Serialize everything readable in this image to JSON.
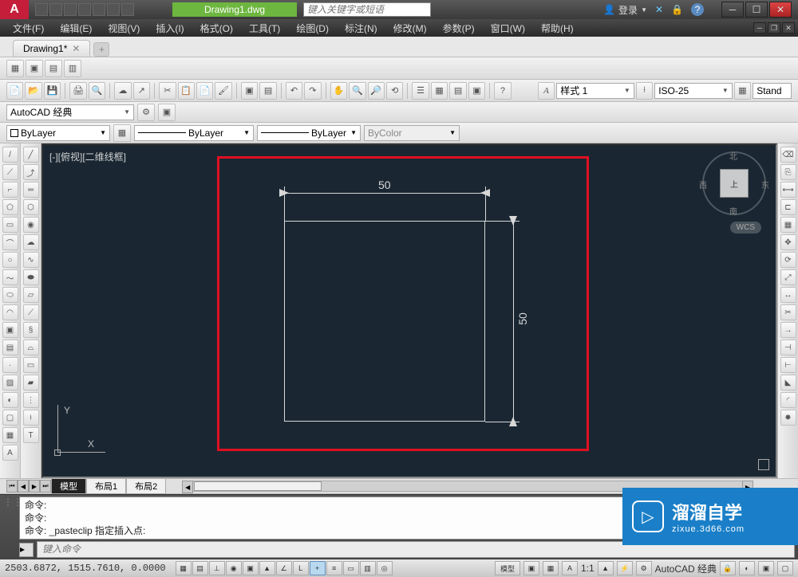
{
  "titlebar": {
    "filename": "Drawing1.dwg",
    "search_placeholder": "键入关键字或短语",
    "login_label": "登录"
  },
  "menu": {
    "items": [
      "文件(F)",
      "编辑(E)",
      "视图(V)",
      "插入(I)",
      "格式(O)",
      "工具(T)",
      "绘图(D)",
      "标注(N)",
      "修改(M)",
      "参数(P)",
      "窗口(W)",
      "帮助(H)"
    ]
  },
  "filetab": {
    "name": "Drawing1*"
  },
  "workspace": {
    "name": "AutoCAD 经典"
  },
  "style_combo": {
    "label": "样式 1"
  },
  "dim_style": {
    "label": "ISO-25"
  },
  "standard": {
    "label": "Stand"
  },
  "layer": {
    "current": "ByLayer",
    "linetype": "ByLayer",
    "lineweight": "ByLayer",
    "color": "ByColor"
  },
  "viewport": {
    "label": "[-][俯视][二维线框]"
  },
  "viewcube": {
    "face": "上",
    "n": "北",
    "s": "南",
    "e": "东",
    "w": "西",
    "wcs": "WCS"
  },
  "ucs": {
    "x": "X",
    "y": "Y"
  },
  "dimensions": {
    "horizontal": "50",
    "vertical": "50"
  },
  "layout_tabs": {
    "model": "模型",
    "layout1": "布局1",
    "layout2": "布局2"
  },
  "command": {
    "line1": "命令:",
    "line2": "命令:",
    "line3": "命令: _pasteclip 指定插入点:",
    "input_placeholder": "键入命令"
  },
  "statusbar": {
    "coords": "2503.6872, 1515.7610, 0.0000",
    "model_btn": "模型",
    "scale": "1:1",
    "workspace": "AutoCAD 经典"
  },
  "watermark": {
    "main": "溜溜自学",
    "sub": "zixue.3d66.com"
  }
}
